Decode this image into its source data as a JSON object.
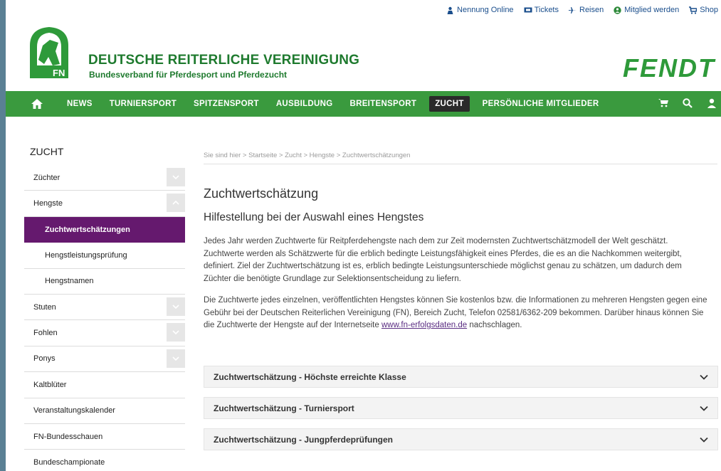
{
  "utility": [
    {
      "icon": "person-badge-icon",
      "label": "Nennung Online"
    },
    {
      "icon": "ticket-icon",
      "label": "Tickets"
    },
    {
      "icon": "plane-icon",
      "label": "Reisen"
    },
    {
      "icon": "member-icon",
      "label": "Mitglied werden"
    },
    {
      "icon": "cart-icon",
      "label": "Shop"
    }
  ],
  "header": {
    "org_title": "DEUTSCHE REITERLICHE VEREINIGUNG",
    "org_sub": "Bundesverband für Pferdesport und Pferdezucht",
    "logo_text": "FN",
    "sponsor": "FENDT"
  },
  "nav": {
    "items": [
      "NEWS",
      "TURNIERSPORT",
      "SPITZENSPORT",
      "AUSBILDUNG",
      "BREITENSPORT",
      "ZUCHT",
      "PERSÖNLICHE MITGLIEDER"
    ],
    "active": "ZUCHT"
  },
  "sidebar": {
    "title": "ZUCHT",
    "items": [
      {
        "label": "Züchter"
      },
      {
        "label": "Hengste"
      },
      {
        "label": "Zuchtwertschätzungen"
      },
      {
        "label": "Hengstleistungsprüfung"
      },
      {
        "label": "Hengstnamen"
      },
      {
        "label": "Stuten"
      },
      {
        "label": "Fohlen"
      },
      {
        "label": "Ponys"
      },
      {
        "label": "Kaltblüter"
      },
      {
        "label": "Veranstaltungskalender"
      },
      {
        "label": "FN-Bundesschauen"
      },
      {
        "label": "Bundeschampionate"
      }
    ]
  },
  "breadcrumb": {
    "prefix": "Sie sind hier",
    "items": [
      "Startseite",
      "Zucht",
      "Hengste",
      "Zuchtwertschätzungen"
    ]
  },
  "main": {
    "title": "Zuchtwertschätzung",
    "subtitle": "Hilfestellung bei der Auswahl eines Hengstes",
    "para1": "Jedes Jahr werden Zuchtwerte für Reitpferdehengste nach dem zur Zeit modernsten Zuchtwertschätzmodell der Welt geschätzt. Zuchtwerte werden als Schätzwerte für die erblich bedingte Leistungsfähigkeit eines Pferdes, die es an die Nachkommen weitergibt, definiert. Ziel der Zuchtwertschätzung ist es, erblich bedingte Leistungsunterschiede möglichst genau zu schätzen, um dadurch dem Züchter die benötigte Grundlage zur Selektionsentscheidung zu liefern.",
    "para2_before": "Die Zuchtwerte jedes einzelnen, veröffentlichten Hengstes können Sie kostenlos bzw. die Informationen zu mehreren Hengsten gegen eine Gebühr bei der Deutschen Reiterlichen Vereinigung (FN), Bereich Zucht, Telefon 02581/6362-209 bekommen. Darüber hinaus können Sie die Zuchtwerte der Hengste auf der Internetseite ",
    "para2_link": "www.fn-erfolgsdaten.de",
    "para2_after": " nachschlagen.",
    "accordions": [
      "Zuchtwertschätzung - Höchste erreichte Klasse",
      "Zuchtwertschätzung - Turniersport",
      "Zuchtwertschätzung - Jungpferdeprüfungen"
    ]
  },
  "colors": {
    "brand_green": "#3a9a3e",
    "title_green": "#1e7a2e",
    "active_purple": "#65196e",
    "link_blue": "#1a4e8c"
  }
}
